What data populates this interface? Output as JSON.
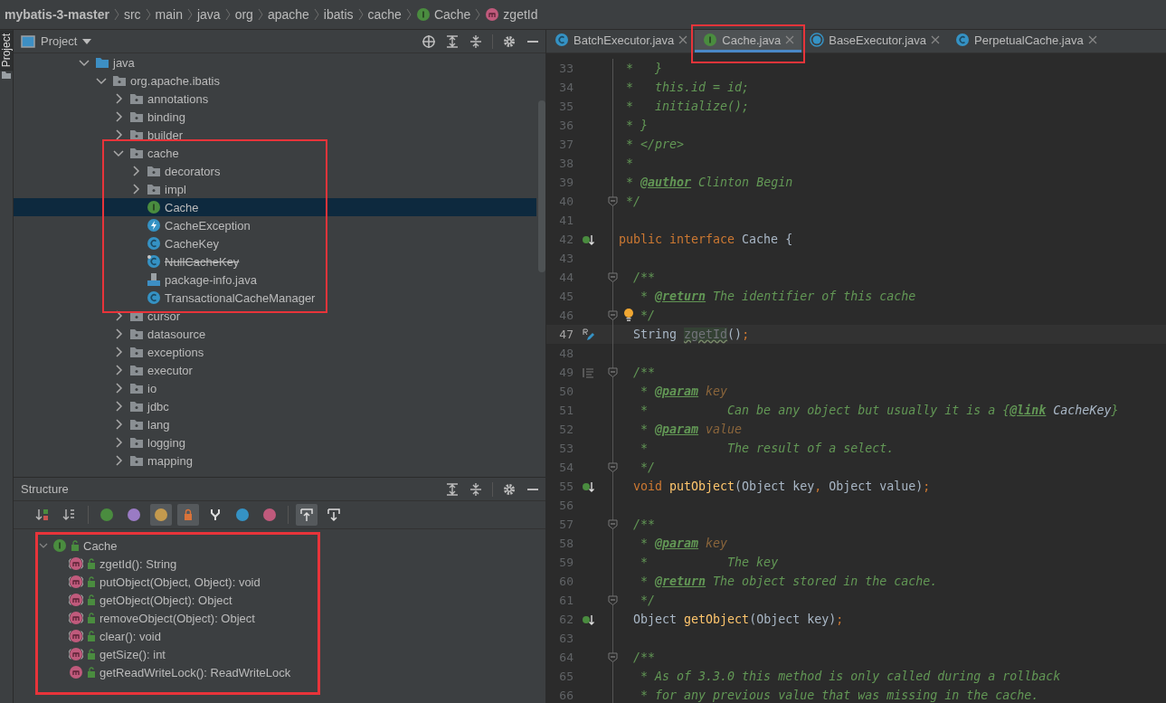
{
  "breadcrumbs": [
    {
      "label": "mybatis-3-master",
      "kind": "project"
    },
    {
      "label": "src",
      "kind": "dir"
    },
    {
      "label": "main",
      "kind": "dir"
    },
    {
      "label": "java",
      "kind": "dir"
    },
    {
      "label": "org",
      "kind": "dir"
    },
    {
      "label": "apache",
      "kind": "dir"
    },
    {
      "label": "ibatis",
      "kind": "dir"
    },
    {
      "label": "cache",
      "kind": "dir"
    },
    {
      "label": "Cache",
      "kind": "interface"
    },
    {
      "label": "zgetId",
      "kind": "method"
    }
  ],
  "side_tabs": [
    {
      "label": "Project",
      "selected": true
    }
  ],
  "project_panel": {
    "title": "Project",
    "tree": [
      {
        "label": "java",
        "kind": "source-folder",
        "expanded": true,
        "selected": false,
        "highlighted": false,
        "children": [
          {
            "label": "org.apache.ibatis",
            "kind": "package",
            "expanded": true,
            "selected": false,
            "highlighted": false,
            "children": [
              {
                "label": "annotations",
                "kind": "package",
                "expanded": false,
                "selected": false,
                "highlighted": false
              },
              {
                "label": "binding",
                "kind": "package",
                "expanded": false,
                "selected": false,
                "highlighted": false
              },
              {
                "label": "builder",
                "kind": "package",
                "expanded": false,
                "selected": false,
                "highlighted": false
              },
              {
                "label": "cache",
                "kind": "package",
                "expanded": true,
                "selected": false,
                "highlighted": true,
                "children": [
                  {
                    "label": "decorators",
                    "kind": "package",
                    "expanded": false,
                    "selected": false,
                    "highlighted": false
                  },
                  {
                    "label": "impl",
                    "kind": "package",
                    "expanded": false,
                    "selected": false,
                    "highlighted": false
                  },
                  {
                    "label": "Cache",
                    "kind": "interface",
                    "selected": true,
                    "highlighted": false
                  },
                  {
                    "label": "CacheException",
                    "kind": "exception",
                    "selected": false,
                    "highlighted": false
                  },
                  {
                    "label": "CacheKey",
                    "kind": "class",
                    "selected": false,
                    "highlighted": false
                  },
                  {
                    "label": "NullCacheKey",
                    "kind": "deprecated-class",
                    "selected": false,
                    "highlighted": false
                  },
                  {
                    "label": "package-info.java",
                    "kind": "file",
                    "selected": false,
                    "highlighted": false
                  },
                  {
                    "label": "TransactionalCacheManager",
                    "kind": "class",
                    "selected": false,
                    "highlighted": false
                  }
                ]
              },
              {
                "label": "cursor",
                "kind": "package",
                "expanded": false,
                "selected": false,
                "highlighted": false
              },
              {
                "label": "datasource",
                "kind": "package",
                "expanded": false,
                "selected": false,
                "highlighted": false
              },
              {
                "label": "exceptions",
                "kind": "package",
                "expanded": false,
                "selected": false,
                "highlighted": false
              },
              {
                "label": "executor",
                "kind": "package",
                "expanded": false,
                "selected": false,
                "highlighted": false
              },
              {
                "label": "io",
                "kind": "package",
                "expanded": false,
                "selected": false,
                "highlighted": false
              },
              {
                "label": "jdbc",
                "kind": "package",
                "expanded": false,
                "selected": false,
                "highlighted": false
              },
              {
                "label": "lang",
                "kind": "package",
                "expanded": false,
                "selected": false,
                "highlighted": false
              },
              {
                "label": "logging",
                "kind": "package",
                "expanded": false,
                "selected": false,
                "highlighted": false
              },
              {
                "label": "mapping",
                "kind": "package",
                "expanded": false,
                "selected": false,
                "highlighted": false
              }
            ]
          }
        ]
      }
    ]
  },
  "structure_panel": {
    "title": "Structure",
    "highlighted": true,
    "toolbar": [
      {
        "kind": "sort-visibility",
        "selected": false
      },
      {
        "kind": "sort-alpha",
        "selected": false
      },
      {
        "kind": "separator"
      },
      {
        "kind": "badge",
        "color": "#4a8c3f",
        "selected": false
      },
      {
        "kind": "badge",
        "color": "#9a7bc4",
        "selected": false
      },
      {
        "kind": "badge",
        "color": "#c49a4e",
        "selected": true
      },
      {
        "kind": "lock",
        "selected": true
      },
      {
        "kind": "fork",
        "selected": false
      },
      {
        "kind": "badge",
        "color": "#3592c4",
        "selected": false
      },
      {
        "kind": "badge",
        "color": "#c05a7c",
        "selected": false
      },
      {
        "kind": "separator"
      },
      {
        "kind": "scroll-to-source",
        "selected": true
      },
      {
        "kind": "scroll-from-source",
        "selected": false
      }
    ],
    "tree": [
      {
        "label": "Cache",
        "kind": "interface",
        "expanded": true,
        "children": [
          {
            "label": "zgetId(): String",
            "kind": "abstract-method"
          },
          {
            "label": "putObject(Object, Object): void",
            "kind": "abstract-method"
          },
          {
            "label": "getObject(Object): Object",
            "kind": "abstract-method"
          },
          {
            "label": "removeObject(Object): Object",
            "kind": "abstract-method"
          },
          {
            "label": "clear(): void",
            "kind": "abstract-method"
          },
          {
            "label": "getSize(): int",
            "kind": "abstract-method"
          },
          {
            "label": "getReadWriteLock(): ReadWriteLock",
            "kind": "method"
          }
        ]
      }
    ]
  },
  "editor": {
    "tabs": [
      {
        "label": "BatchExecutor.java",
        "kind": "class",
        "selected": false,
        "highlighted": false
      },
      {
        "label": "Cache.java",
        "kind": "interface",
        "selected": true,
        "highlighted": true
      },
      {
        "label": "BaseExecutor.java",
        "kind": "abstract-class",
        "selected": false,
        "highlighted": false
      },
      {
        "label": "PerpetualCache.java",
        "kind": "class",
        "selected": false,
        "highlighted": false
      }
    ],
    "lines": [
      {
        "number": "33",
        "kind": "plain",
        "fold": false,
        "current": false,
        "bulb": false,
        "tokens": [
          {
            "kind": "comment",
            "text": " *   }"
          }
        ]
      },
      {
        "number": "34",
        "kind": "plain",
        "fold": false,
        "current": false,
        "bulb": false,
        "tokens": [
          {
            "kind": "comment",
            "text": " *   this.id = id;"
          }
        ]
      },
      {
        "number": "35",
        "kind": "plain",
        "fold": false,
        "current": false,
        "bulb": false,
        "tokens": [
          {
            "kind": "comment",
            "text": " *   initialize();"
          }
        ]
      },
      {
        "number": "36",
        "kind": "plain",
        "fold": false,
        "current": false,
        "bulb": false,
        "tokens": [
          {
            "kind": "comment",
            "text": " * }"
          }
        ]
      },
      {
        "number": "37",
        "kind": "plain",
        "fold": false,
        "current": false,
        "bulb": false,
        "tokens": [
          {
            "kind": "comment",
            "text": " * </pre>"
          }
        ]
      },
      {
        "number": "38",
        "kind": "plain",
        "fold": false,
        "current": false,
        "bulb": false,
        "tokens": [
          {
            "kind": "comment",
            "text": " *"
          }
        ]
      },
      {
        "number": "39",
        "kind": "plain",
        "fold": false,
        "current": false,
        "bulb": false,
        "tokens": [
          {
            "kind": "comment",
            "text": " * "
          },
          {
            "kind": "doctag",
            "text": "@author"
          },
          {
            "kind": "comment",
            "text": " Clinton Begin"
          }
        ]
      },
      {
        "number": "40",
        "kind": "plain",
        "fold": true,
        "current": false,
        "bulb": false,
        "tokens": [
          {
            "kind": "comment",
            "text": " */"
          }
        ]
      },
      {
        "number": "41",
        "kind": "plain",
        "fold": false,
        "current": false,
        "bulb": false
      },
      {
        "number": "42",
        "kind": "implemented",
        "fold": false,
        "current": false,
        "bulb": false,
        "tokens": [
          {
            "kind": "keyword",
            "text": "public interface "
          },
          {
            "kind": "plain",
            "text": "Cache {"
          }
        ]
      },
      {
        "number": "43",
        "kind": "plain",
        "fold": false,
        "current": false,
        "bulb": false
      },
      {
        "number": "44",
        "kind": "plain",
        "fold": true,
        "current": false,
        "bulb": false,
        "tokens": [
          {
            "kind": "comment",
            "text": "  /**"
          }
        ]
      },
      {
        "number": "45",
        "kind": "plain",
        "fold": false,
        "current": false,
        "bulb": false,
        "tokens": [
          {
            "kind": "comment",
            "text": "   * "
          },
          {
            "kind": "doctag",
            "text": "@return"
          },
          {
            "kind": "comment",
            "text": " The identifier of this cache"
          }
        ]
      },
      {
        "number": "46",
        "kind": "plain",
        "fold": true,
        "current": false,
        "bulb": true,
        "tokens": [
          {
            "kind": "comment",
            "text": "   */"
          }
        ]
      },
      {
        "number": "47",
        "kind": "rename",
        "fold": false,
        "current": true,
        "bulb": false,
        "tokens": [
          {
            "kind": "plain",
            "text": "  String "
          },
          {
            "kind": "unused",
            "text": "zgetId"
          },
          {
            "kind": "plain",
            "text": "()"
          },
          {
            "kind": "punct",
            "text": ";"
          }
        ]
      },
      {
        "number": "48",
        "kind": "plain",
        "fold": false,
        "current": false,
        "bulb": false
      },
      {
        "number": "49",
        "kind": "doc",
        "fold": true,
        "current": false,
        "bulb": false,
        "tokens": [
          {
            "kind": "comment",
            "text": "  /**"
          }
        ]
      },
      {
        "number": "50",
        "kind": "plain",
        "fold": false,
        "current": false,
        "bulb": false,
        "tokens": [
          {
            "kind": "comment",
            "text": "   * "
          },
          {
            "kind": "doctag",
            "text": "@param"
          },
          {
            "kind": "docparam",
            "text": " key"
          }
        ]
      },
      {
        "number": "51",
        "kind": "plain",
        "fold": false,
        "current": false,
        "bulb": false,
        "tokens": [
          {
            "kind": "comment",
            "text": "   *           Can be any object but usually it is a {"
          },
          {
            "kind": "doctag",
            "text": "@link"
          },
          {
            "kind": "docref",
            "text": " CacheKey"
          },
          {
            "kind": "comment",
            "text": "}"
          }
        ]
      },
      {
        "number": "52",
        "kind": "plain",
        "fold": false,
        "current": false,
        "bulb": false,
        "tokens": [
          {
            "kind": "comment",
            "text": "   * "
          },
          {
            "kind": "doctag",
            "text": "@param"
          },
          {
            "kind": "docparam",
            "text": " value"
          }
        ]
      },
      {
        "number": "53",
        "kind": "plain",
        "fold": false,
        "current": false,
        "bulb": false,
        "tokens": [
          {
            "kind": "comment",
            "text": "   *           The result of a select."
          }
        ]
      },
      {
        "number": "54",
        "kind": "plain",
        "fold": true,
        "current": false,
        "bulb": false,
        "tokens": [
          {
            "kind": "comment",
            "text": "   */"
          }
        ]
      },
      {
        "number": "55",
        "kind": "implemented",
        "fold": false,
        "current": false,
        "bulb": false,
        "tokens": [
          {
            "kind": "keyword",
            "text": "  void "
          },
          {
            "kind": "method",
            "text": "putObject"
          },
          {
            "kind": "plain",
            "text": "(Object key"
          },
          {
            "kind": "punct",
            "text": ", "
          },
          {
            "kind": "plain",
            "text": "Object value)"
          },
          {
            "kind": "punct",
            "text": ";"
          }
        ]
      },
      {
        "number": "56",
        "kind": "plain",
        "fold": false,
        "current": false,
        "bulb": false
      },
      {
        "number": "57",
        "kind": "plain",
        "fold": true,
        "current": false,
        "bulb": false,
        "tokens": [
          {
            "kind": "comment",
            "text": "  /**"
          }
        ]
      },
      {
        "number": "58",
        "kind": "plain",
        "fold": false,
        "current": false,
        "bulb": false,
        "tokens": [
          {
            "kind": "comment",
            "text": "   * "
          },
          {
            "kind": "doctag",
            "text": "@param"
          },
          {
            "kind": "docparam",
            "text": " key"
          }
        ]
      },
      {
        "number": "59",
        "kind": "plain",
        "fold": false,
        "current": false,
        "bulb": false,
        "tokens": [
          {
            "kind": "comment",
            "text": "   *           The key"
          }
        ]
      },
      {
        "number": "60",
        "kind": "plain",
        "fold": false,
        "current": false,
        "bulb": false,
        "tokens": [
          {
            "kind": "comment",
            "text": "   * "
          },
          {
            "kind": "doctag",
            "text": "@return"
          },
          {
            "kind": "comment",
            "text": " The object stored in the cache."
          }
        ]
      },
      {
        "number": "61",
        "kind": "plain",
        "fold": true,
        "current": false,
        "bulb": false,
        "tokens": [
          {
            "kind": "comment",
            "text": "   */"
          }
        ]
      },
      {
        "number": "62",
        "kind": "implemented",
        "fold": false,
        "current": false,
        "bulb": false,
        "tokens": [
          {
            "kind": "plain",
            "text": "  Object "
          },
          {
            "kind": "method",
            "text": "getObject"
          },
          {
            "kind": "plain",
            "text": "(Object key)"
          },
          {
            "kind": "punct",
            "text": ";"
          }
        ]
      },
      {
        "number": "63",
        "kind": "plain",
        "fold": false,
        "current": false,
        "bulb": false
      },
      {
        "number": "64",
        "kind": "plain",
        "fold": true,
        "current": false,
        "bulb": false,
        "tokens": [
          {
            "kind": "comment",
            "text": "  /**"
          }
        ]
      },
      {
        "number": "65",
        "kind": "plain",
        "fold": false,
        "current": false,
        "bulb": false,
        "tokens": [
          {
            "kind": "comment",
            "text": "   * As of 3.3.0 this method is only called during a rollback"
          }
        ]
      },
      {
        "number": "66",
        "kind": "plain",
        "fold": false,
        "current": false,
        "bulb": false,
        "tokens": [
          {
            "kind": "comment",
            "text": "   * for any previous value that was missing in the cache."
          }
        ]
      }
    ]
  }
}
